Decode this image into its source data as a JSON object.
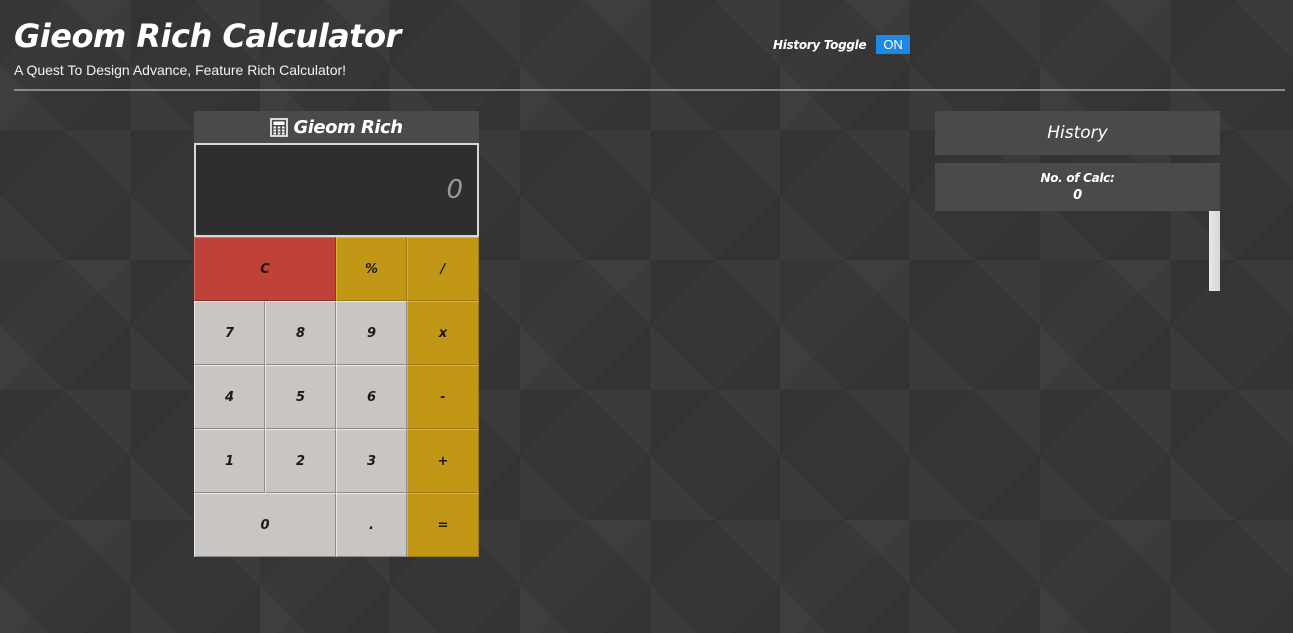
{
  "header": {
    "title": "Gieom Rich Calculator",
    "subtitle": "A Quest To Design Advance, Feature Rich Calculator!"
  },
  "history_toggle": {
    "label": "History Toggle",
    "state": "ON",
    "color": "#1e88e5"
  },
  "calculator": {
    "title": "Gieom Rich",
    "icon": "calculator-icon",
    "display_value": "0",
    "keys": [
      {
        "label": "C",
        "type": "clear",
        "name": "clear-button"
      },
      {
        "label": "%",
        "type": "op",
        "name": "percent-button"
      },
      {
        "label": "/",
        "type": "op",
        "name": "divide-button"
      },
      {
        "label": "7",
        "type": "num",
        "name": "digit-7-button"
      },
      {
        "label": "8",
        "type": "num",
        "name": "digit-8-button"
      },
      {
        "label": "9",
        "type": "num",
        "name": "digit-9-button"
      },
      {
        "label": "x",
        "type": "op",
        "name": "multiply-button"
      },
      {
        "label": "4",
        "type": "num",
        "name": "digit-4-button"
      },
      {
        "label": "5",
        "type": "num",
        "name": "digit-5-button"
      },
      {
        "label": "6",
        "type": "num",
        "name": "digit-6-button"
      },
      {
        "label": "-",
        "type": "op",
        "name": "subtract-button"
      },
      {
        "label": "1",
        "type": "num",
        "name": "digit-1-button"
      },
      {
        "label": "2",
        "type": "num",
        "name": "digit-2-button"
      },
      {
        "label": "3",
        "type": "num",
        "name": "digit-3-button"
      },
      {
        "label": "+",
        "type": "op",
        "name": "add-button"
      },
      {
        "label": "0",
        "type": "zero",
        "name": "digit-0-button"
      },
      {
        "label": ".",
        "type": "num",
        "name": "decimal-button"
      },
      {
        "label": "=",
        "type": "op",
        "name": "equals-button"
      }
    ],
    "colors": {
      "clear": "#be4238",
      "operator": "#c39716",
      "number": "#c9c5c3"
    }
  },
  "history": {
    "title": "History",
    "count_label": "No. of Calc:",
    "count_value": "0"
  }
}
